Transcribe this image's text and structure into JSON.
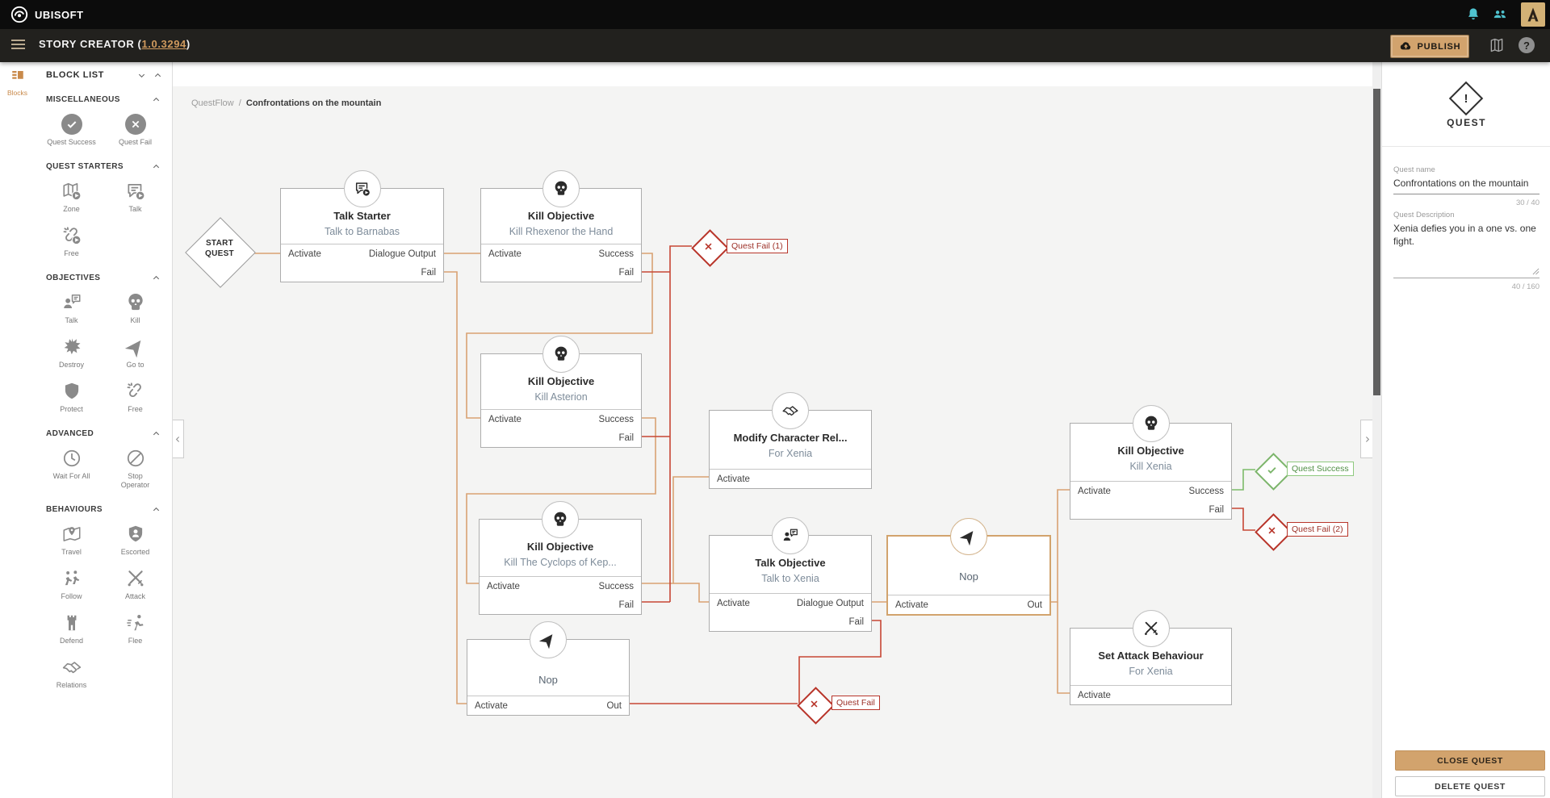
{
  "app": {
    "brand": "UBISOFT",
    "title_prefix": "STORY CREATOR (",
    "version": "1.0.3294",
    "title_suffix": ")",
    "publish_label": "PUBLISH",
    "help_label": "?"
  },
  "nav_rail": {
    "blocks_label": "Blocks"
  },
  "block_list": {
    "title": "BLOCK LIST",
    "sections": [
      {
        "title": "MISCELLANEOUS",
        "items": [
          {
            "label": "Quest Success",
            "icon": "quest-success-icon"
          },
          {
            "label": "Quest Fail",
            "icon": "quest-fail-icon"
          }
        ]
      },
      {
        "title": "QUEST STARTERS",
        "items": [
          {
            "label": "Zone",
            "icon": "zone-icon"
          },
          {
            "label": "Talk",
            "icon": "talk-starter-icon"
          },
          {
            "label": "Free",
            "icon": "free-starter-icon"
          }
        ]
      },
      {
        "title": "OBJECTIVES",
        "items": [
          {
            "label": "Talk",
            "icon": "talk-objective-icon"
          },
          {
            "label": "Kill",
            "icon": "kill-icon"
          },
          {
            "label": "Destroy",
            "icon": "destroy-icon"
          },
          {
            "label": "Go to",
            "icon": "goto-icon"
          },
          {
            "label": "Protect",
            "icon": "protect-icon"
          },
          {
            "label": "Free",
            "icon": "free-icon"
          }
        ]
      },
      {
        "title": "ADVANCED",
        "items": [
          {
            "label": "Wait For All",
            "icon": "wait-for-all-icon"
          },
          {
            "label": "Stop Operator",
            "icon": "stop-operator-icon"
          }
        ]
      },
      {
        "title": "BEHAVIOURS",
        "items": [
          {
            "label": "Travel",
            "icon": "travel-icon"
          },
          {
            "label": "Escorted",
            "icon": "escorted-icon"
          },
          {
            "label": "Follow",
            "icon": "follow-icon"
          },
          {
            "label": "Attack",
            "icon": "attack-icon"
          },
          {
            "label": "Defend",
            "icon": "defend-icon"
          },
          {
            "label": "Flee",
            "icon": "flee-icon"
          },
          {
            "label": "Relations",
            "icon": "relations-icon"
          }
        ]
      }
    ]
  },
  "canvas": {
    "breadcrumb": {
      "parent": "QuestFlow",
      "separator": "/",
      "current": "Confrontations on the mountain"
    },
    "start_line1": "START",
    "start_line2": "QUEST",
    "nodes": [
      {
        "title": "Talk Starter",
        "subtitle": "Talk to Barnabas",
        "activate": "Activate",
        "outputs": [
          "Dialogue Output",
          "Fail"
        ]
      },
      {
        "title": "Kill Objective",
        "subtitle": "Kill Rhexenor the Hand",
        "activate": "Activate",
        "outputs": [
          "Success",
          "Fail"
        ]
      },
      {
        "title": "Kill Objective",
        "subtitle": "Kill Asterion",
        "activate": "Activate",
        "outputs": [
          "Success",
          "Fail"
        ]
      },
      {
        "title": "Modify Character Rel...",
        "subtitle": "For Xenia",
        "activate": "Activate",
        "outputs": []
      },
      {
        "title": "Kill Objective",
        "subtitle": "Kill The Cyclops of Kep...",
        "activate": "Activate",
        "outputs": [
          "Success",
          "Fail"
        ]
      },
      {
        "title": "Talk Objective",
        "subtitle": "Talk to Xenia",
        "activate": "Activate",
        "outputs": [
          "Dialogue Output",
          "Fail"
        ]
      },
      {
        "title": "Nop",
        "activate": "Activate",
        "outputs": [
          "Out"
        ]
      },
      {
        "title": "Kill Objective",
        "subtitle": "Kill Xenia",
        "activate": "Activate",
        "outputs": [
          "Success",
          "Fail"
        ]
      },
      {
        "title": "Set Attack Behaviour",
        "subtitle": "For Xenia",
        "activate": "Activate",
        "outputs": []
      },
      {
        "title": "Nop",
        "activate": "Activate",
        "outputs": [
          "Out"
        ]
      }
    ],
    "terminals": [
      {
        "label": "Quest Fail (1)",
        "kind": "fail"
      },
      {
        "label": "Quest Success",
        "kind": "success"
      },
      {
        "label": "Quest Fail (2)",
        "kind": "fail"
      },
      {
        "label": "Quest Fail",
        "kind": "fail"
      }
    ]
  },
  "inspector": {
    "icon_char": "!",
    "type_label": "QUEST",
    "name_label": "Quest name",
    "name_value": "Confrontations on the mountain",
    "name_counter": "30 / 40",
    "desc_label": "Quest Description",
    "desc_value": "Xenia defies you in a one vs. one fight.",
    "desc_counter": "40 / 160",
    "close_button": "CLOSE QUEST",
    "delete_button": "DELETE QUEST"
  },
  "colors": {
    "accent_tan": "#d2a36d",
    "edge_orange": "#d9a273",
    "edge_red": "#c74634",
    "edge_green": "#7dbb6a",
    "fail_red": "#b8352a",
    "success_green": "#7cb56b",
    "topbar_teal": "#4fc3cf",
    "canvas_bg": "#f4f4f3"
  }
}
